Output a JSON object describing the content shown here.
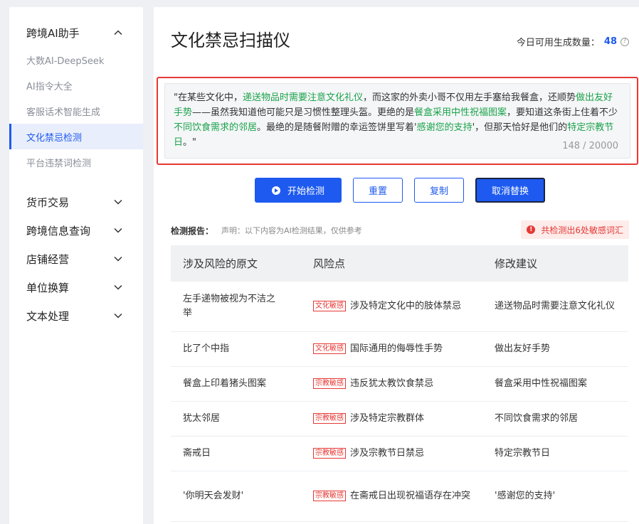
{
  "sidebar": {
    "group_title": "跨境AI助手",
    "sub_items": [
      {
        "label": "大数AI-DeepSeek",
        "active": false
      },
      {
        "label": "AI指令大全",
        "active": false
      },
      {
        "label": "客服话术智能生成",
        "active": false
      },
      {
        "label": "文化禁忌检测",
        "active": true
      },
      {
        "label": "平台违禁词检测",
        "active": false
      }
    ],
    "nav_items": [
      {
        "label": "货币交易"
      },
      {
        "label": "跨境信息查询"
      },
      {
        "label": "店铺经营"
      },
      {
        "label": "单位换算"
      },
      {
        "label": "文本处理"
      }
    ]
  },
  "header": {
    "title": "文化禁忌扫描仪",
    "quota_label": "今日可用生成数量：",
    "quota_value": "48",
    "help_icon": "question-circle-icon"
  },
  "input": {
    "segments": [
      {
        "text": "\"在某些文化中，",
        "hl": false
      },
      {
        "text": "递送物品时需要注意文化礼仪",
        "hl": true
      },
      {
        "text": "，而这家的外卖小哥不仅用左手塞给我餐盒，还顺势",
        "hl": false
      },
      {
        "text": "做出友好手势",
        "hl": true
      },
      {
        "text": "——虽然我知道他可能只是习惯性整理头盔。更绝的是",
        "hl": false
      },
      {
        "text": "餐盒采用中性祝福图案",
        "hl": true
      },
      {
        "text": "，要知道这条街上住着不少",
        "hl": false
      },
      {
        "text": "不同饮食需求的邻居",
        "hl": true
      },
      {
        "text": "。最绝的是随餐附赠的幸运签饼里写着'",
        "hl": false
      },
      {
        "text": "感谢您的支持",
        "hl": true
      },
      {
        "text": "'，但那天恰好是他们的",
        "hl": false
      },
      {
        "text": "特定宗教节日",
        "hl": true
      },
      {
        "text": "。\"",
        "hl": false
      }
    ],
    "counter": "148 / 20000"
  },
  "buttons": {
    "start": "开始检测",
    "reset": "重置",
    "copy": "复制",
    "cancel_replace": "取消替换"
  },
  "report": {
    "label": "检测报告：",
    "note": "声明：以下内容为AI检测结果，仅供参考",
    "alert": "共检测出6处敏感词汇"
  },
  "table": {
    "headers": [
      "涉及风险的原文",
      "风险点",
      "修改建议"
    ],
    "rows": [
      {
        "original": "左手递物被视为不洁之举",
        "tag": "文化敏感",
        "risk": "涉及特定文化中的肢体禁忌",
        "suggestion": "递送物品时需要注意文化礼仪"
      },
      {
        "original": "比了个中指",
        "tag": "文化敏感",
        "risk": "国际通用的侮辱性手势",
        "suggestion": "做出友好手势"
      },
      {
        "original": "餐盒上印着猪头图案",
        "tag": "宗教敏感",
        "risk": "违反犹太教饮食禁忌",
        "suggestion": "餐盒采用中性祝福图案"
      },
      {
        "original": "犹太邻居",
        "tag": "宗教敏感",
        "risk": "涉及特定宗教群体",
        "suggestion": "不同饮食需求的邻居"
      },
      {
        "original": "斋戒日",
        "tag": "宗教敏感",
        "risk": "涉及宗教节日禁忌",
        "suggestion": "特定宗教节日"
      },
      {
        "original": "'你明天会发财'",
        "tag": "宗教敏感",
        "risk": "在斋戒日出现祝福语存在冲突",
        "suggestion": "'感谢您的支持'"
      }
    ]
  },
  "colors": {
    "accent": "#1e5af0",
    "highlight": "#1aa34a",
    "danger": "#e53935"
  }
}
